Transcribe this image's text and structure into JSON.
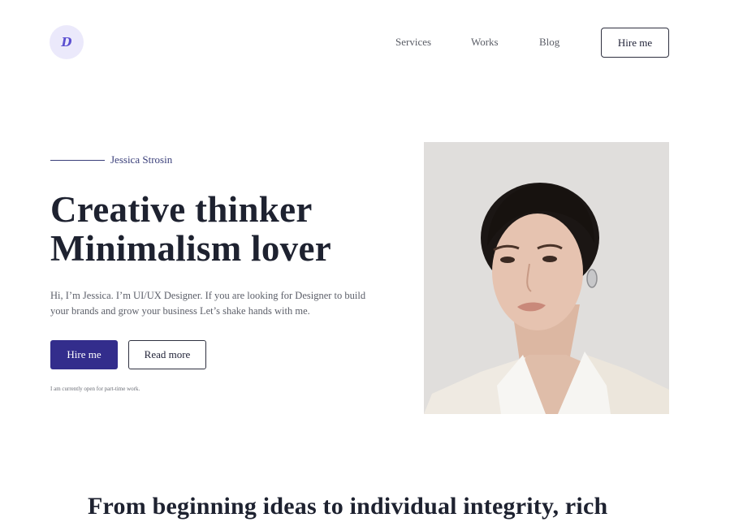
{
  "header": {
    "logo_glyph": "D",
    "nav": [
      "Services",
      "Works",
      "Blog"
    ],
    "cta": "Hire me"
  },
  "hero": {
    "eyebrow": "Jessica Strosin",
    "headline": [
      "Creative thinker",
      "Minimalism lover"
    ],
    "intro": "Hi, I’m Jessica. I’m UI/UX Designer. If you are looking for Designer to build your brands and grow your business Let’s shake hands with me.",
    "primary_button": "Hire me",
    "secondary_button": "Read more",
    "availability": "I am currently open for part-time work."
  },
  "section": {
    "heading": "From beginning ideas to individual integrity, rich"
  },
  "colors": {
    "accent": "#332d8c",
    "text": "#1e2230",
    "logo_bg": "#ebe9fb"
  }
}
